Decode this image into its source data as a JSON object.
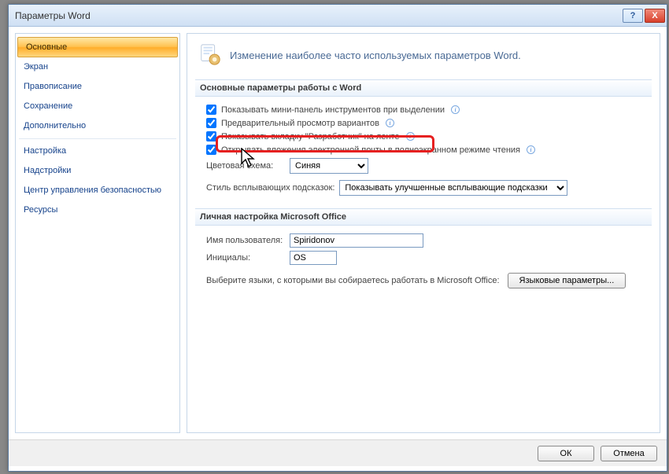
{
  "window": {
    "title": "Параметры Word",
    "help": "?",
    "close": "X"
  },
  "sidebar": {
    "items": [
      "Основные",
      "Экран",
      "Правописание",
      "Сохранение",
      "Дополнительно",
      "Настройка",
      "Надстройки",
      "Центр управления безопасностью",
      "Ресурсы"
    ]
  },
  "content": {
    "heading": "Изменение наиболее часто используемых параметров Word.",
    "section1": "Основные параметры работы с Word",
    "opt1": "Показывать мини-панель инструментов при выделении",
    "opt2": "Предварительный просмотр вариантов",
    "opt3": "Показывать вкладку \"Разработчик\" на ленте",
    "opt4": "Открывать вложения электронной почты в полноэкранном режиме чтения",
    "color_label": "Цветовая схема:",
    "color_value": "Синяя",
    "tips_label": "Стиль всплывающих подсказок:",
    "tips_value": "Показывать улучшенные всплывающие подсказки",
    "section2": "Личная настройка Microsoft Office",
    "username_label": "Имя пользователя:",
    "username_value": "Spiridonov",
    "initials_label": "Инициалы:",
    "initials_value": "OS",
    "lang_text": "Выберите языки, с которыми вы собираетесь работать в Microsoft Office:",
    "lang_btn": "Языковые параметры..."
  },
  "footer": {
    "ok": "OК",
    "cancel": "Отмена"
  }
}
